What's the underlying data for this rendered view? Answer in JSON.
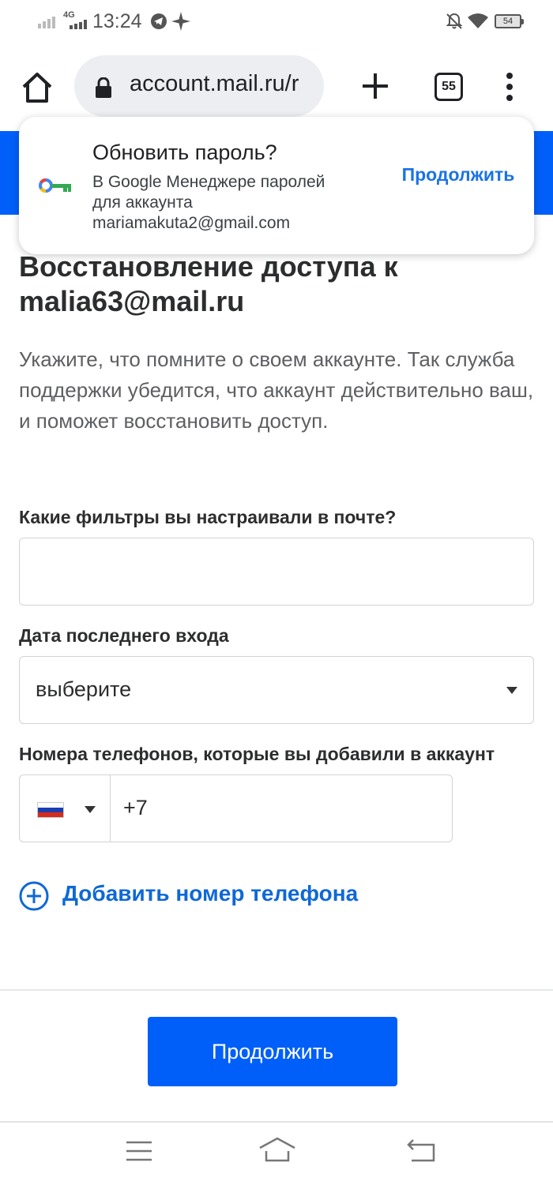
{
  "status_bar": {
    "time": "13:24",
    "network": "4G",
    "battery": "54",
    "icons": [
      "signal-icon",
      "telegram-icon",
      "sparkle-icon",
      "mute-icon",
      "wifi-icon",
      "battery-icon"
    ]
  },
  "browser": {
    "url": "account.mail.ru/r",
    "tab_count": "55",
    "icons": [
      "home-icon",
      "lock-icon",
      "plus-icon",
      "tabs-icon",
      "more-vert-icon"
    ]
  },
  "password_prompt": {
    "title": "Обновить пароль?",
    "description_line1": "В Google Менеджере паролей",
    "description_line2": "для аккаунта",
    "email": "mariamakuta2@gmail.com",
    "action": "Продолжить",
    "icon": "key-icon"
  },
  "main": {
    "title_line1": "Восстановление доступа к",
    "title_line2": "malia63@mail.ru",
    "intro": "Укажите, что помните о своем аккаунте. Так служба поддержки убедится, что аккаунт действительно ваш, и поможет восстановить доступ."
  },
  "form": {
    "filters_label": "Какие фильтры вы настраивали в почте?",
    "filters_value": "",
    "last_login_label": "Дата последнего входа",
    "last_login_value": "выберите",
    "phones_label": "Номера телефонов, которые вы добавили в аккаунт",
    "phone_country": "RU",
    "phone_prefix": "+7",
    "add_phone": "Добавить номер телефона",
    "submit": "Продолжить"
  },
  "colors": {
    "brand_blue": "#005ff9",
    "link_blue": "#0f68d6",
    "google_blue": "#1a73e8"
  },
  "nav_bar": {
    "icons": [
      "menu-icon",
      "home-icon",
      "back-icon"
    ]
  }
}
